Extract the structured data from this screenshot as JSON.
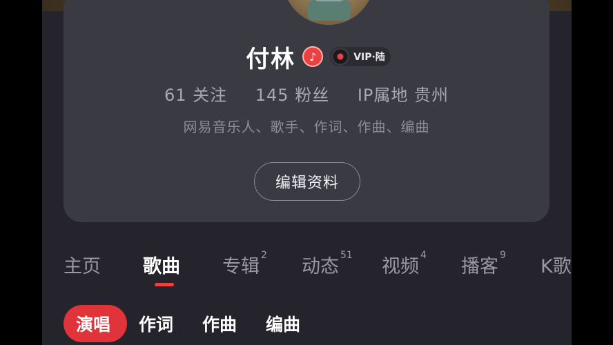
{
  "profile": {
    "name": "付林",
    "vip_label": "VIP·陆",
    "stats": {
      "following": "61 关注",
      "followers": "145 粉丝",
      "ip_location": "IP属地 贵州"
    },
    "bio": "网易音乐人、歌手、作词、作曲、编曲",
    "edit_button": "编辑资料"
  },
  "tabs": [
    {
      "label": "主页",
      "count": ""
    },
    {
      "label": "歌曲",
      "count": ""
    },
    {
      "label": "专辑",
      "count": "2"
    },
    {
      "label": "动态",
      "count": "51"
    },
    {
      "label": "视频",
      "count": "4"
    },
    {
      "label": "播客",
      "count": "9"
    },
    {
      "label": "K歌",
      "count": ""
    }
  ],
  "active_tab": "歌曲",
  "song_filters": [
    "演唱",
    "作词",
    "作曲",
    "编曲"
  ],
  "active_filter": "演唱",
  "colors": {
    "accent_red": "#ec4141",
    "card_bg": "#3a3a43",
    "page_bg": "#25242c"
  },
  "icons": {
    "music_badge": "music-note-icon",
    "vip_badge": "vinyl-disc-icon"
  }
}
